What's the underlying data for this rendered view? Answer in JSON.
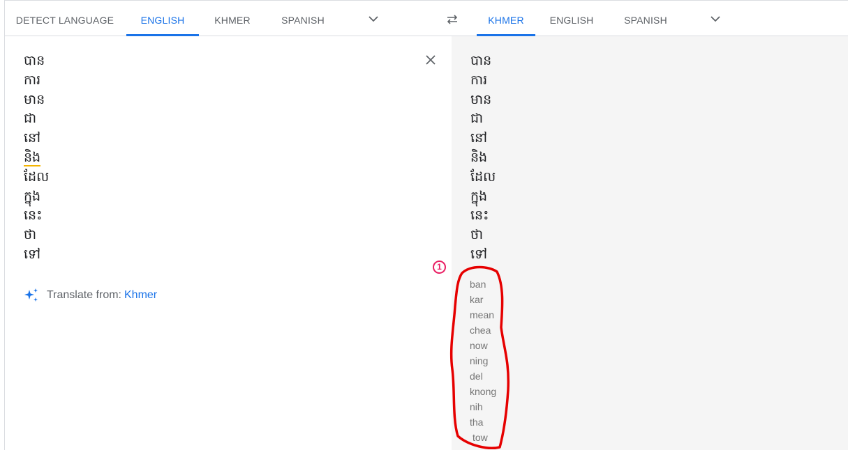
{
  "source_tabs": [
    "DETECT LANGUAGE",
    "ENGLISH",
    "KHMER",
    "SPANISH"
  ],
  "target_tabs": [
    "KHMER",
    "ENGLISH",
    "SPANISH"
  ],
  "source_words": [
    "បាន",
    "ការ",
    "មាន",
    "ជា",
    "នៅ",
    "និង",
    "ដែល",
    "ក្នុង",
    "នេះ",
    "ថា",
    "ទៅ"
  ],
  "target_words": [
    "បាន",
    "ការ",
    "មាន",
    "ជា",
    "នៅ",
    "និង",
    "ដែល",
    "ក្នុង",
    "នេះ",
    "ថា",
    "ទៅ"
  ],
  "romanization": [
    "ban",
    "kar",
    "mean",
    "chea",
    "now",
    "ning",
    "del",
    "knong",
    "nih",
    "tha",
    "tow"
  ],
  "translate_from": {
    "label": "Translate from:",
    "language": "Khmer"
  },
  "annotation_number": "1",
  "colors": {
    "accent": "#1a73e8",
    "annotation": "#e60000",
    "badge": "#e91e63"
  }
}
